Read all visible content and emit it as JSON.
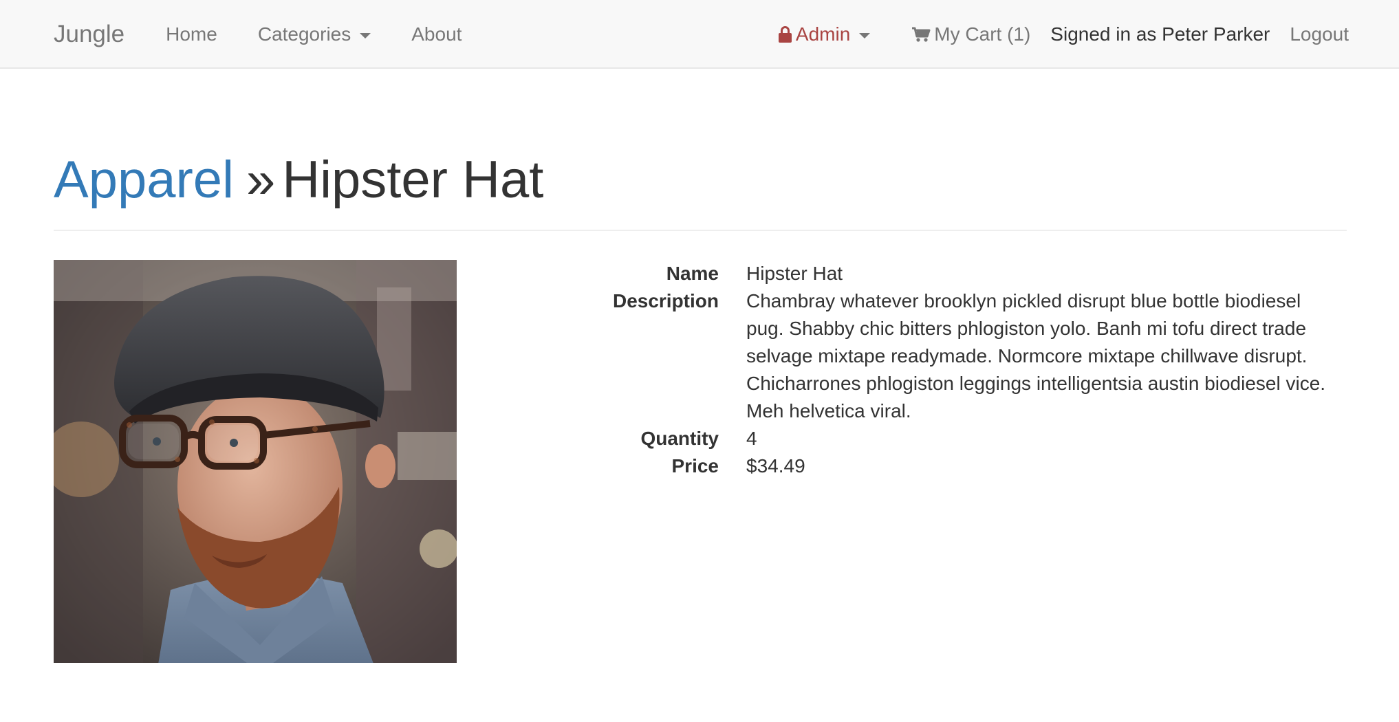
{
  "nav": {
    "brand": "Jungle",
    "home": "Home",
    "categories": "Categories",
    "about": "About",
    "admin": "Admin",
    "cart": "My Cart (1)",
    "signed_in": "Signed in as Peter Parker",
    "logout": "Logout"
  },
  "header": {
    "category": "Apparel",
    "separator": "»",
    "product_name": "Hipster Hat"
  },
  "product": {
    "image_alt": "Hipster Hat",
    "fields": [
      {
        "label": "Name",
        "value": "Hipster Hat"
      },
      {
        "label": "Description",
        "value": "Chambray whatever brooklyn pickled disrupt blue bottle biodiesel pug. Shabby chic bitters phlogiston yolo. Banh mi tofu direct trade selvage mixtape readymade. Normcore mixtape chillwave disrupt. Chicharrones phlogiston leggings intelligentsia austin biodiesel vice. Meh helvetica viral."
      },
      {
        "label": "Quantity",
        "value": "4"
      },
      {
        "label": "Price",
        "value": "$34.49"
      }
    ]
  },
  "colors": {
    "navbar_bg": "#f8f8f8",
    "nav_text": "#777777",
    "admin": "#a94442",
    "link": "#337ab7",
    "text": "#333333"
  },
  "icons": {
    "admin": "lock-icon",
    "cart": "shopping-cart-icon",
    "dropdown": "caret-down-icon"
  }
}
